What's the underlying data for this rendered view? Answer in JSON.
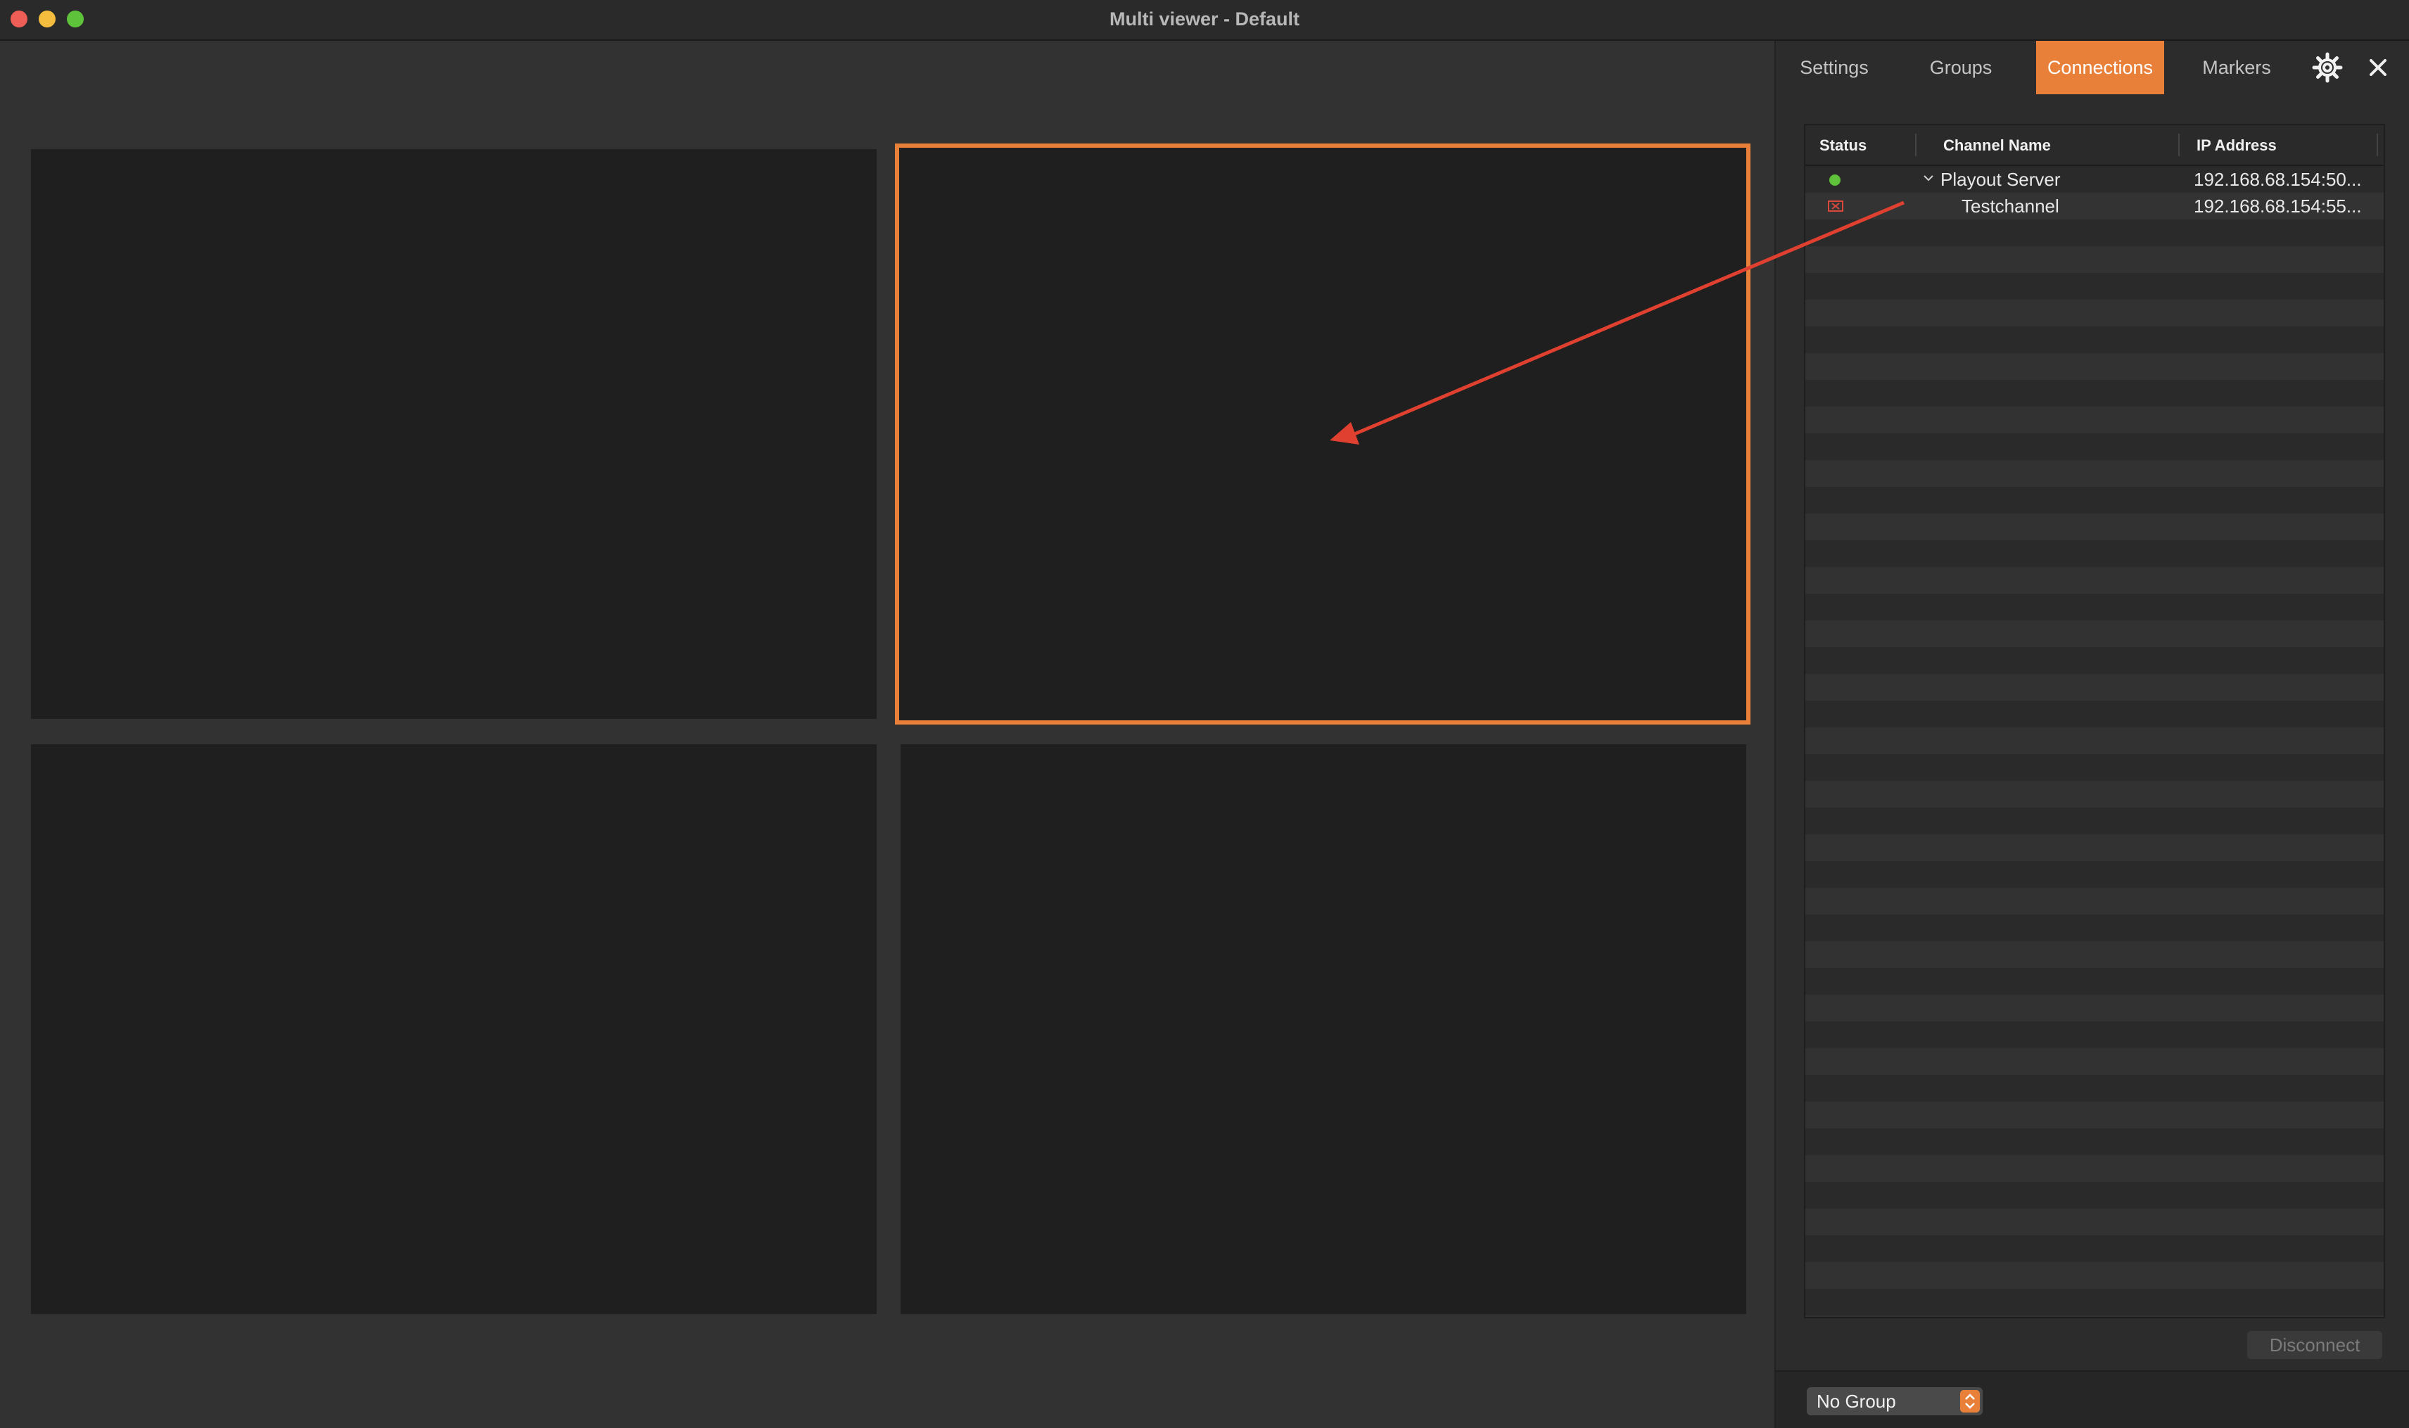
{
  "window": {
    "title": "Multi viewer - Default"
  },
  "panel": {
    "tabs": {
      "settings": "Settings",
      "groups": "Groups",
      "connections": "Connections",
      "markers": "Markers"
    },
    "active_tab": "Connections",
    "table": {
      "headers": {
        "status": "Status",
        "channel": "Channel Name",
        "ip": "IP Address"
      },
      "rows": [
        {
          "status": "connected",
          "channel": "Playout Server",
          "ip": "192.168.68.154:50..."
        },
        {
          "status": "error",
          "channel": "Testchannel",
          "ip": "192.168.68.154:55..."
        }
      ]
    },
    "disconnect_label": "Disconnect",
    "group_select": {
      "selected": "No Group"
    }
  },
  "colors": {
    "accent": "#e9803a",
    "status_ok": "#5fc23b",
    "status_error": "#d9483a",
    "annotation_arrow": "#e0402f"
  },
  "icons": [
    "gear-icon",
    "close-icon",
    "chevron-down-icon",
    "error-icon",
    "status-dot-icon",
    "stepper-icon"
  ]
}
